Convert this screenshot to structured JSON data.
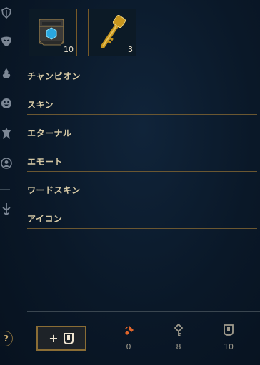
{
  "rail": {
    "icons": [
      "shield-crest-icon",
      "mask-icon",
      "flame-icon",
      "smiley-icon",
      "ward-totem-icon",
      "profile-icon",
      "sword-down-icon"
    ]
  },
  "tiles": [
    {
      "name": "chest",
      "count": "10"
    },
    {
      "name": "key",
      "count": "3"
    }
  ],
  "categories": [
    {
      "label": "チャンピオン"
    },
    {
      "label": "スキン"
    },
    {
      "label": "エターナル"
    },
    {
      "label": "エモート"
    },
    {
      "label": "ワードスキン"
    },
    {
      "label": "アイコン"
    }
  ],
  "footer": {
    "craft_plus": "+",
    "help": "?",
    "currencies": [
      {
        "icon": "key-fragment-icon",
        "value": "0",
        "color": "#e0652b"
      },
      {
        "icon": "key-icon",
        "value": "8",
        "color": "#a09b8c"
      },
      {
        "icon": "chest-icon",
        "value": "10",
        "color": "#a09b8c"
      }
    ]
  },
  "colors": {
    "gold": "#c8aa6e",
    "border_gold": "#785a28",
    "orange": "#e0652b"
  }
}
